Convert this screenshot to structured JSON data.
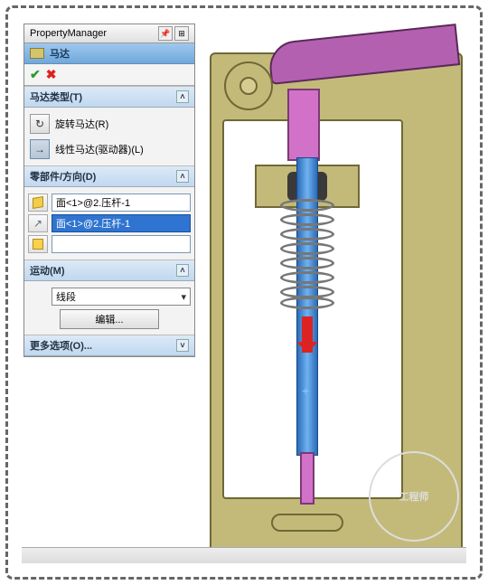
{
  "pm": {
    "title": "PropertyManager",
    "feature_name": "马达",
    "sections": {
      "motor_type": {
        "title": "马达类型(T)",
        "rotary": "旋转马达(R)",
        "linear": "线性马达(驱动器)(L)"
      },
      "component": {
        "title": "零部件/方向(D)",
        "face_field": "面<1>@2.压杆-1",
        "direction_field": "面<1>@2.压杆-1",
        "third_field": ""
      },
      "motion": {
        "title": "运动(M)",
        "type_selected": "线段",
        "edit_button": "编辑..."
      },
      "more": {
        "title": "更多选项(O)..."
      }
    }
  },
  "watermark_text": "工程师"
}
